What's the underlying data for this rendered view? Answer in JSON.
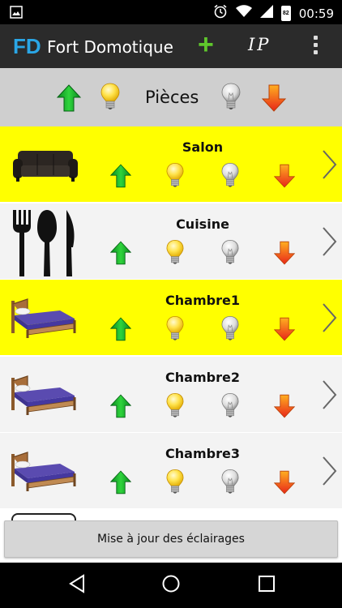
{
  "status_bar": {
    "time": "00:59",
    "battery": "82",
    "left_icon": "image-icon",
    "right_icons": [
      "alarm-icon",
      "wifi-icon",
      "signal-icon",
      "battery-icon"
    ]
  },
  "app_bar": {
    "logo": "FD",
    "title": "Fort Domotique",
    "add_icon": "plus-icon",
    "ip_label": "IP",
    "overflow_icon": "more-vert-icon"
  },
  "header": {
    "label": "Pièces",
    "icons": [
      "up-arrow-icon",
      "bulb-on-icon",
      "bulb-off-icon",
      "down-arrow-icon"
    ]
  },
  "rooms": [
    {
      "name": "Salon",
      "icon": "sofa-icon",
      "highlighted": true
    },
    {
      "name": "Cuisine",
      "icon": "cutlery-icon",
      "highlighted": false
    },
    {
      "name": "Chambre1",
      "icon": "bed-icon",
      "highlighted": true
    },
    {
      "name": "Chambre2",
      "icon": "bed-icon",
      "highlighted": false
    },
    {
      "name": "Chambre3",
      "icon": "bed-icon",
      "highlighted": false
    }
  ],
  "update_button": {
    "label": "Mise à jour des éclairages"
  },
  "colors": {
    "highlight": "#ffff00",
    "row_default": "#f3f3f3",
    "header_bg": "#cfcfcf",
    "app_bar": "#2b2b2b",
    "logo": "#2aa6e6",
    "plus": "#5fc72c"
  },
  "nav_bar": {
    "icons": [
      "back-icon",
      "home-icon",
      "recents-icon"
    ]
  }
}
